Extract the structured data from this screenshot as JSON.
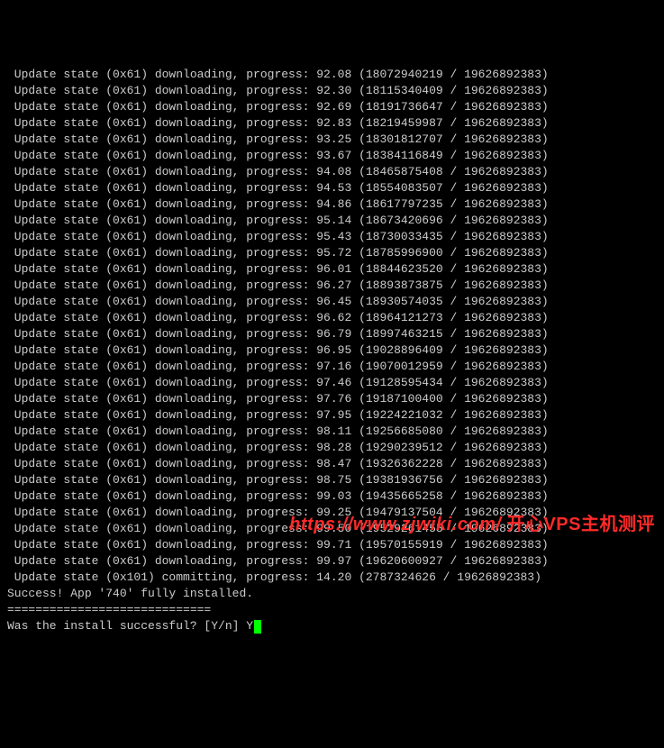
{
  "total_bytes": "19626892383",
  "state_code": "0x61",
  "state_name": "downloading",
  "progress_lines": [
    {
      "pct": "92.08",
      "cur": "18072940219"
    },
    {
      "pct": "92.30",
      "cur": "18115340409"
    },
    {
      "pct": "92.69",
      "cur": "18191736647"
    },
    {
      "pct": "92.83",
      "cur": "18219459987"
    },
    {
      "pct": "93.25",
      "cur": "18301812707"
    },
    {
      "pct": "93.67",
      "cur": "18384116849"
    },
    {
      "pct": "94.08",
      "cur": "18465875408"
    },
    {
      "pct": "94.53",
      "cur": "18554083507"
    },
    {
      "pct": "94.86",
      "cur": "18617797235"
    },
    {
      "pct": "95.14",
      "cur": "18673420696"
    },
    {
      "pct": "95.43",
      "cur": "18730033435"
    },
    {
      "pct": "95.72",
      "cur": "18785996900"
    },
    {
      "pct": "96.01",
      "cur": "18844623520"
    },
    {
      "pct": "96.27",
      "cur": "18893873875"
    },
    {
      "pct": "96.45",
      "cur": "18930574035"
    },
    {
      "pct": "96.62",
      "cur": "18964121273"
    },
    {
      "pct": "96.79",
      "cur": "18997463215"
    },
    {
      "pct": "96.95",
      "cur": "19028896409"
    },
    {
      "pct": "97.16",
      "cur": "19070012959"
    },
    {
      "pct": "97.46",
      "cur": "19128595434"
    },
    {
      "pct": "97.76",
      "cur": "19187100400"
    },
    {
      "pct": "97.95",
      "cur": "19224221032"
    },
    {
      "pct": "98.11",
      "cur": "19256685080"
    },
    {
      "pct": "98.28",
      "cur": "19290239512"
    },
    {
      "pct": "98.47",
      "cur": "19326362228"
    },
    {
      "pct": "98.75",
      "cur": "19381936756"
    },
    {
      "pct": "99.03",
      "cur": "19435665258"
    },
    {
      "pct": "99.25",
      "cur": "19479137504"
    },
    {
      "pct": "99.50",
      "cur": "19529261455"
    },
    {
      "pct": "99.71",
      "cur": "19570155919"
    },
    {
      "pct": "99.97",
      "cur": "19620600927"
    }
  ],
  "commit_line": {
    "state_code": "0x101",
    "state_name": "committing",
    "pct": "14.20",
    "cur": "2787324626",
    "total": "19626892383"
  },
  "success_line": "Success! App '740' fully installed.",
  "separator": "=============================",
  "prompt_text": "Was the install successful? [Y/n] ",
  "prompt_input": "Y",
  "watermark": {
    "url": "https://www.zjwiki.com/",
    "cn": "开心VPS主机测评"
  }
}
